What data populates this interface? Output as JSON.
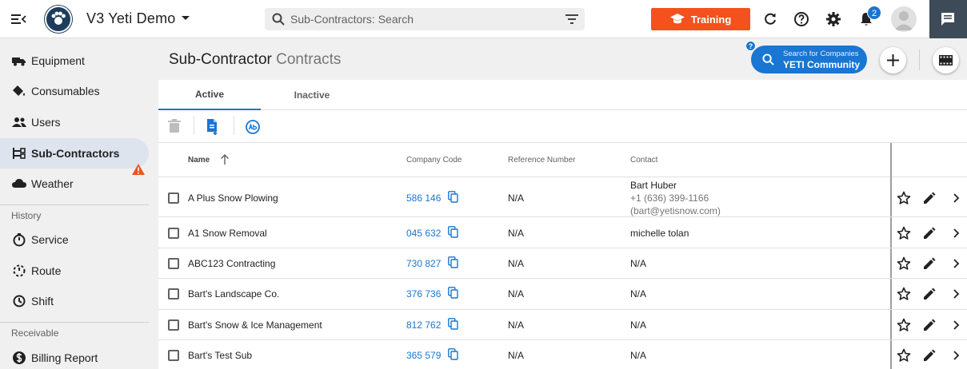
{
  "header": {
    "app_title": "V3 Yeti Demo",
    "search_placeholder": "Sub-Contractors: Search",
    "training_label": "Training",
    "notification_count": "2",
    "accent": "#1976d2",
    "training_color": "#f4511e"
  },
  "sidebar": {
    "items": [
      {
        "label": "Equipment",
        "icon": "truck-icon"
      },
      {
        "label": "Consumables",
        "icon": "paint-bucket-icon"
      },
      {
        "label": "Users",
        "icon": "users-icon"
      },
      {
        "label": "Sub-Contractors",
        "icon": "hierarchy-icon",
        "active": true
      },
      {
        "label": "Weather",
        "icon": "cloud-icon"
      }
    ],
    "history_label": "History",
    "history_items": [
      {
        "label": "Service",
        "icon": "timer-icon"
      },
      {
        "label": "Route",
        "icon": "route-icon"
      },
      {
        "label": "Shift",
        "icon": "clock-icon"
      }
    ],
    "receivable_label": "Receivable",
    "receivable_items": [
      {
        "label": "Billing Report",
        "icon": "dollar-icon"
      }
    ]
  },
  "page": {
    "title": "Sub-Contractor",
    "subtitle": "Contracts",
    "community_line1": "Search for Companies",
    "community_line2": "YETI Community",
    "help_badge": "?"
  },
  "tabs": [
    {
      "label": "Active",
      "active": true
    },
    {
      "label": "Inactive",
      "active": false
    }
  ],
  "table": {
    "columns": {
      "name": "Name",
      "company_code": "Company Code",
      "reference_number": "Reference Number",
      "contact": "Contact"
    },
    "rows": [
      {
        "name": "A Plus Snow Plowing",
        "code": "586 146",
        "ref": "N/A",
        "contact": "Bart Huber",
        "phone": "+1 (636) 399-1166",
        "email": "(bart@yetisnow.com)"
      },
      {
        "name": "A1 Snow Removal",
        "code": "045 632",
        "ref": "N/A",
        "contact": "michelle tolan"
      },
      {
        "name": "ABC123 Contracting",
        "code": "730 827",
        "ref": "N/A",
        "contact": "N/A"
      },
      {
        "name": "Bart's Landscape Co.",
        "code": "376 736",
        "ref": "N/A",
        "contact": "N/A"
      },
      {
        "name": "Bart's Snow & Ice Management",
        "code": "812 762",
        "ref": "N/A",
        "contact": "N/A"
      },
      {
        "name": "Bart's Test Sub",
        "code": "365 579",
        "ref": "N/A",
        "contact": "N/A"
      }
    ]
  }
}
